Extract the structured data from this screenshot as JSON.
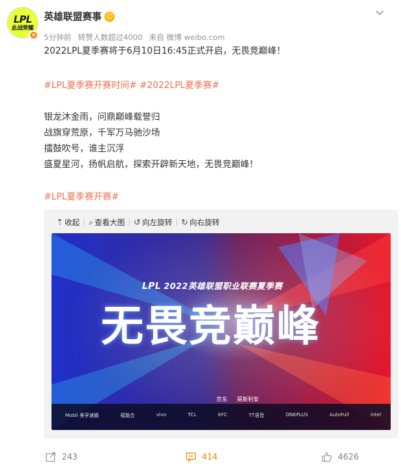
{
  "post": {
    "author": "英雄联盟赛事",
    "avatar_text": "LPL",
    "avatar_subtext": "此战荣耀",
    "meta": {
      "time": "5分钟前",
      "reposts_info": "转赞人数超过4000",
      "source": "来自 微博 weibo.com"
    },
    "headline": "2022LPL夏季赛将于6月10日16:45正式开启，无畏竞巅峰！",
    "hashtags_line": "#LPL夏季赛开赛时间# #2022LPL夏季赛#",
    "poem": [
      "银龙沐金雨，问鼎巅峰载誉归",
      "战旗穿荒原，千军万马驰沙场",
      "擂鼓吹号，谁主沉浮",
      "盛夏星河，扬帆启航，探索开辟新天地，无畏竞巅峰！"
    ],
    "closing_tag": "#LPL夏季赛开赛#"
  },
  "media_toolbar": {
    "collapse": "收起",
    "view_large": "查看大图",
    "rotate_left": "向左旋转",
    "rotate_right": "向右旋转"
  },
  "poster": {
    "brand": "LPL",
    "event_line": "2022英雄联盟职业联赛夏季赛",
    "slogan": "无畏竞巅峰",
    "sponsors": [
      "Mobil 美孚速霸",
      "福能合",
      "vivo",
      "TCL",
      "KFC",
      "TT语音",
      "ONEPLUS",
      "AutoFull",
      "intel"
    ],
    "sponsor_top": [
      "京东",
      "莫斯利安"
    ]
  },
  "actions": {
    "repost_count": "243",
    "comment_count": "414",
    "like_count": "4626"
  },
  "colors": {
    "tag": "#eb7350",
    "accent": "#ff8200",
    "meta": "#939393"
  }
}
